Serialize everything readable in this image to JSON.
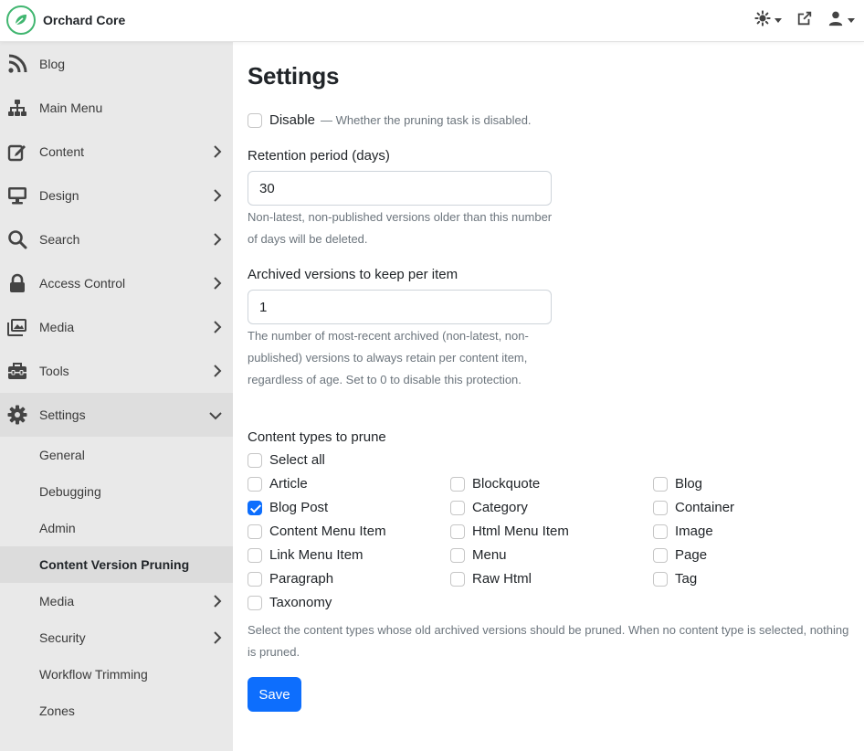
{
  "app": {
    "name": "Orchard Core",
    "brand_color": "#41b670"
  },
  "topbar": {
    "icons": [
      "theme-toggle-icon",
      "external-link-icon",
      "user-icon"
    ]
  },
  "sidebar": {
    "items": [
      {
        "label": "Blog",
        "icon": "rss-icon"
      },
      {
        "label": "Main Menu",
        "icon": "sitemap-icon"
      },
      {
        "label": "Content",
        "icon": "edit-icon"
      },
      {
        "label": "Design",
        "icon": "desktop-icon"
      },
      {
        "label": "Search",
        "icon": "search-icon"
      },
      {
        "label": "Access Control",
        "icon": "lock-icon"
      },
      {
        "label": "Media",
        "icon": "images-icon"
      },
      {
        "label": "Tools",
        "icon": "toolbox-icon"
      },
      {
        "label": "Settings",
        "icon": "gear-icon"
      }
    ],
    "settings_children": [
      {
        "label": "General"
      },
      {
        "label": "Debugging"
      },
      {
        "label": "Admin"
      },
      {
        "label": "Content Version Pruning"
      },
      {
        "label": "Media"
      },
      {
        "label": "Security"
      },
      {
        "label": "Workflow Trimming"
      },
      {
        "label": "Zones"
      }
    ]
  },
  "main": {
    "title": "Settings",
    "disable": {
      "label": "Disable",
      "hint": "— Whether the pruning task is disabled.",
      "checked": false
    },
    "retention": {
      "label": "Retention period (days)",
      "value": "30",
      "help": "Non-latest, non-published versions older than this number of days will be deleted."
    },
    "archived": {
      "label": "Archived versions to keep per item",
      "value": "1",
      "help": "The number of most-recent archived (non-latest, non-published) versions to always retain per content item, regardless of age. Set to 0 to disable this protection."
    },
    "content_types": {
      "label": "Content types to prune",
      "select_all": "Select all",
      "items": [
        {
          "label": "Article",
          "checked": false
        },
        {
          "label": "Blockquote",
          "checked": false
        },
        {
          "label": "Blog",
          "checked": false
        },
        {
          "label": "Blog Post",
          "checked": true
        },
        {
          "label": "Category",
          "checked": false
        },
        {
          "label": "Container",
          "checked": false
        },
        {
          "label": "Content Menu Item",
          "checked": false
        },
        {
          "label": "Html Menu Item",
          "checked": false
        },
        {
          "label": "Image",
          "checked": false
        },
        {
          "label": "Link Menu Item",
          "checked": false
        },
        {
          "label": "Menu",
          "checked": false
        },
        {
          "label": "Page",
          "checked": false
        },
        {
          "label": "Paragraph",
          "checked": false
        },
        {
          "label": "Raw Html",
          "checked": false
        },
        {
          "label": "Tag",
          "checked": false
        },
        {
          "label": "Taxonomy",
          "checked": false
        }
      ],
      "help": "Select the content types whose old archived versions should be pruned. When no content type is selected, nothing is pruned."
    },
    "save_label": "Save"
  },
  "colors": {
    "accent": "#0d6efd",
    "sidebar_bg": "#e9e9e9",
    "muted_text": "#6c757d"
  }
}
